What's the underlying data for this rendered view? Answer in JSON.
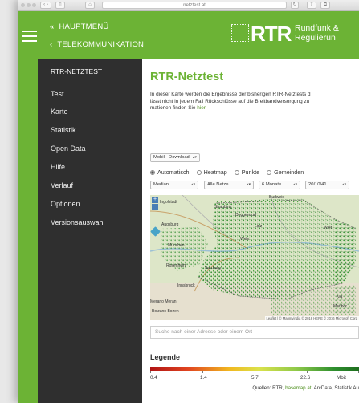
{
  "browser": {
    "url": "netztest.at"
  },
  "header": {
    "nav_main": "HAUPTMENÜ",
    "nav_sub": "TELEKOMMUNIKATION",
    "logo_text": "RTR",
    "logo_line1": "Rundfunk &",
    "logo_line2": "Regulierun",
    "brand_color": "#6cb335"
  },
  "sidebar": {
    "title": "RTR-NETZTEST",
    "items": [
      {
        "label": "Test"
      },
      {
        "label": "Karte"
      },
      {
        "label": "Statistik"
      },
      {
        "label": "Open Data"
      },
      {
        "label": "Hilfe"
      },
      {
        "label": "Verlauf"
      },
      {
        "label": "Optionen"
      },
      {
        "label": "Versionsauswahl"
      }
    ]
  },
  "main": {
    "title": "RTR-Netztest",
    "intro_line1": "In dieser Karte werden die Ergebnisse der bisherigen RTR-Netztests d",
    "intro_line2": "lässt nicht in jedem Fall Rückschlüsse auf die Breitbandversorgung zu",
    "intro_line3_prefix": "mationen finden Sie ",
    "intro_link": "hier",
    "intro_line3_suffix": ".",
    "measurement_select": "Mobil - Download",
    "view_options": [
      {
        "label": "Automatisch",
        "selected": true
      },
      {
        "label": "Heatmap",
        "selected": false
      },
      {
        "label": "Punkte",
        "selected": false
      },
      {
        "label": "Gemeinden",
        "selected": false
      }
    ],
    "filters": {
      "statistic": "Median",
      "network": "Alle Netze",
      "period": "6 Monate",
      "date": "20/10/41"
    }
  },
  "map": {
    "labels": [
      "Ingolstadt",
      "Straubing",
      "Deggendorf",
      "Augsburg",
      "München",
      "Rosenheim",
      "Wels",
      "Salzburg",
      "Wien",
      "Linz",
      "Budweis",
      "Innsbruck",
      "Merano Meran",
      "Bolzano Bozen",
      "Maribor",
      "Kla"
    ],
    "attribution": "Leaflet | © Mapmyindia © 2016 HERE © 2016 Microsoft Corp",
    "search_placeholder": "Suche nach einer Adresse oder einem Ort"
  },
  "legend": {
    "title": "Legende",
    "values": [
      "0.4",
      "1.4",
      "5.7",
      "22.6",
      "Mbit"
    ],
    "sources_prefix": "Quellen: RTR, ",
    "sources_link": "basemap.at",
    "sources_suffix": ", ArcData, Statistik Au"
  }
}
